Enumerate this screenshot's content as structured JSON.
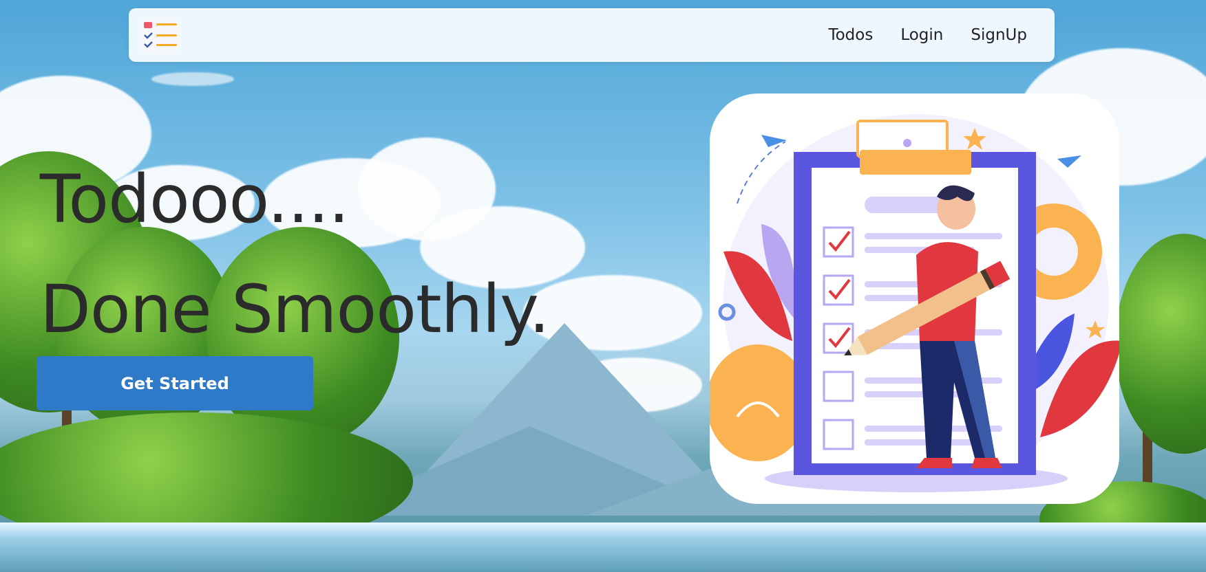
{
  "nav": {
    "logo_icon": "checklist-logo-icon",
    "links": [
      "Todos",
      "Login",
      "SignUp"
    ]
  },
  "hero": {
    "title_line1": "Todooo....",
    "title_line2": "Done Smoothly.",
    "cta_label": "Get Started"
  },
  "illustration": {
    "icon": "clipboard-checklist-illustration",
    "checkboxes": [
      true,
      true,
      true,
      false,
      false
    ]
  },
  "colors": {
    "accent": "#2f79c9",
    "navbar_bg": "#eef6fe",
    "clipboard": "#5b56e0",
    "clip": "#fbb351",
    "check": "#e0383e"
  }
}
